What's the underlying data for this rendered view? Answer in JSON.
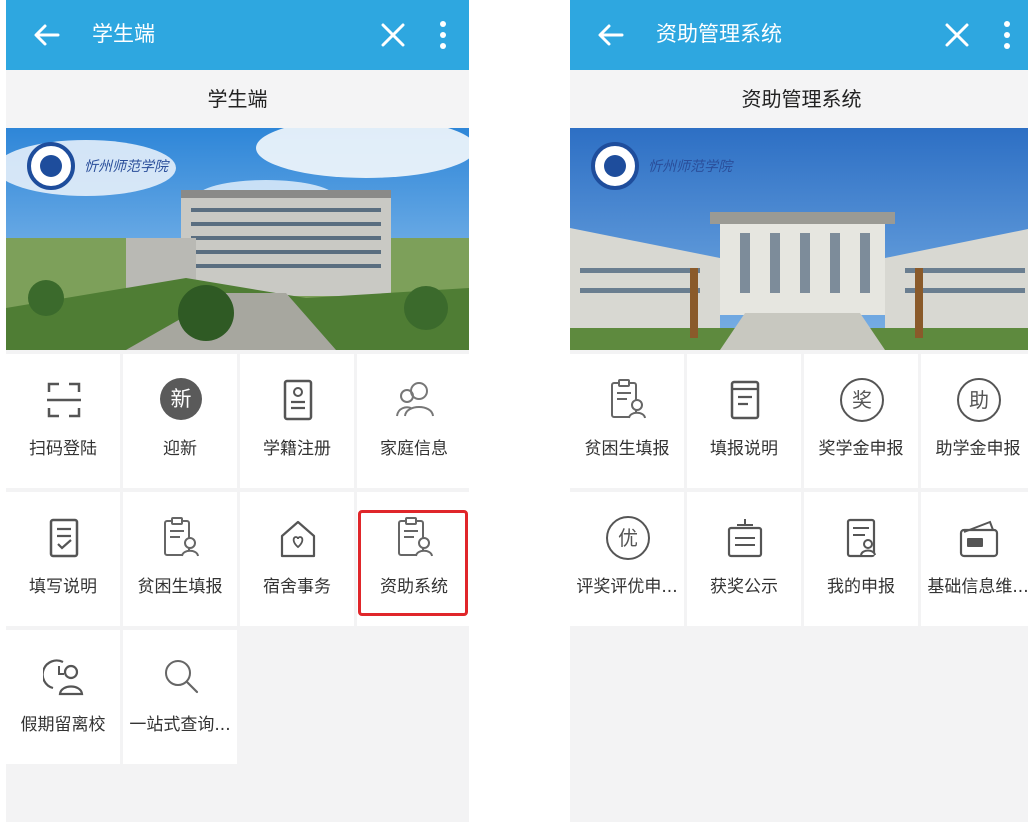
{
  "left_screen": {
    "topbar_title": "学生端",
    "subtitle": "学生端",
    "banner_logo_text": "忻州师范学院",
    "tiles": [
      {
        "label": "扫码登陆",
        "icon": "scan-icon"
      },
      {
        "label": "迎新",
        "icon": "new-badge-icon",
        "badge": "新"
      },
      {
        "label": "学籍注册",
        "icon": "id-card-icon"
      },
      {
        "label": "家庭信息",
        "icon": "family-icon"
      },
      {
        "label": "填写说明",
        "icon": "edit-check-icon"
      },
      {
        "label": "贫困生填报",
        "icon": "clipboard-user-icon"
      },
      {
        "label": "宿舍事务",
        "icon": "house-heart-icon"
      },
      {
        "label": "资助系统",
        "icon": "clipboard-user-icon",
        "highlighted": true
      },
      {
        "label": "假期留离校",
        "icon": "clock-user-icon"
      },
      {
        "label": "一站式查询...",
        "icon": "search-icon"
      }
    ]
  },
  "right_screen": {
    "topbar_title": "资助管理系统",
    "subtitle": "资助管理系统",
    "banner_logo_text": "忻州师范学院",
    "tiles": [
      {
        "label": "贫困生填报",
        "icon": "clipboard-user-icon"
      },
      {
        "label": "填报说明",
        "icon": "document-icon"
      },
      {
        "label": "奖学金申报",
        "icon": "scholarship-icon",
        "badge": "奖"
      },
      {
        "label": "助学金申报",
        "icon": "grant-icon",
        "badge": "助"
      },
      {
        "label": "评奖评优申...",
        "icon": "excellence-icon",
        "badge": "优"
      },
      {
        "label": "获奖公示",
        "icon": "notice-board-icon"
      },
      {
        "label": "我的申报",
        "icon": "my-application-icon"
      },
      {
        "label": "基础信息维...",
        "icon": "id-card-wallet-icon"
      }
    ]
  },
  "colors": {
    "topbar": "#2ea7e0",
    "highlight": "#e0262a",
    "icon": "#555555"
  }
}
